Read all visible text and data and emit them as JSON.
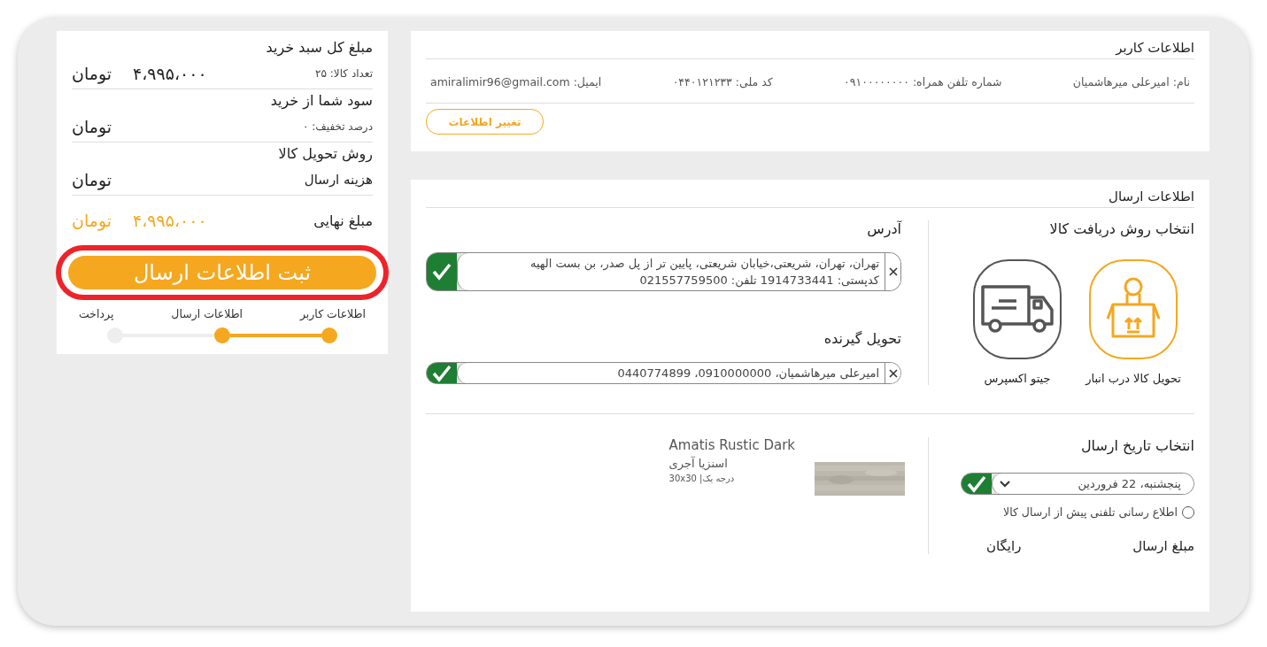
{
  "summary": {
    "rows": [
      {
        "title": "مبلغ کل سبد خرید",
        "detail": "تعداد کالا: ۲۵",
        "kind": "small",
        "amount": "۴،۹۹۵،۰۰۰",
        "currency": "تومان"
      },
      {
        "title": "سود شما از خرید",
        "detail": "درصد تخفیف: ۰",
        "kind": "small",
        "currency": "تومان"
      },
      {
        "title": "روش تحویل کالا",
        "detail": "هزینه ارسال",
        "kind": "large",
        "currency": "تومان"
      }
    ],
    "final": {
      "label": "مبلغ نهایی",
      "amount": "۴،۹۹۵،۰۰۰",
      "currency": "تومان"
    },
    "submit_button": "ثبت اطلاعات ارسال",
    "highlighted": true,
    "steps": [
      {
        "label": "اطلاعات کاربر",
        "done": true
      },
      {
        "label": "اطلاعات ارسال",
        "done": true
      },
      {
        "label": "پرداخت",
        "done": false
      }
    ]
  },
  "user_info": {
    "title": "اطلاعات کاربر",
    "fields": [
      {
        "label": "نام:",
        "value": "امیرعلی میرهاشمیان"
      },
      {
        "label": "شماره تلفن همراه:",
        "value": "۰۹۱۰۰۰۰۰۰۰۰"
      },
      {
        "label": "کد ملی:",
        "value": "۰۴۴۰۱۲۱۲۳۳"
      },
      {
        "label": "ایمیل:",
        "value": "amiralimir96@gmail.com"
      }
    ],
    "edit_button": "تغییر اطلاعات"
  },
  "shipping": {
    "title": "اطلاعات ارسال",
    "method_title": "انتخاب روش دریافت کالا",
    "methods": [
      {
        "label": "تحویل کالا درب انبار",
        "kind": "warehouse",
        "selected": true
      },
      {
        "label": "جیتو اکسپرس",
        "kind": "truck",
        "selected": false
      }
    ],
    "address_title": "آدرس",
    "address": {
      "lines": [
        "تهران، تهران، شریعتی،خیابان شریعتی، پایین تر از پل صدر، بن بست الهیه",
        "کدپستی: 1914733441 تلفن: 021557759500"
      ],
      "confirmed": true
    },
    "recipient_title": "تحویل گیرنده",
    "recipient": {
      "text": "امیرعلی میرهاشمیان، 0910000000، 0440774899",
      "confirmed": true
    },
    "date_title": "انتخاب تاریخ ارسال",
    "date": {
      "value": "پنجشنبه، 22 فروردین",
      "confirmed": true
    },
    "phone_notify": {
      "label": "اطلاع رسانی تلفنی پیش از ارسال کالا",
      "checked": false
    },
    "cost_label": "مبلغ ارسال",
    "cost_value": "رایگان",
    "product": {
      "kind": "picture",
      "name": "Amatis Rustic Dark",
      "subtitle": "اسنزیا آجری",
      "spec": "درجه یک| 30x30"
    }
  }
}
